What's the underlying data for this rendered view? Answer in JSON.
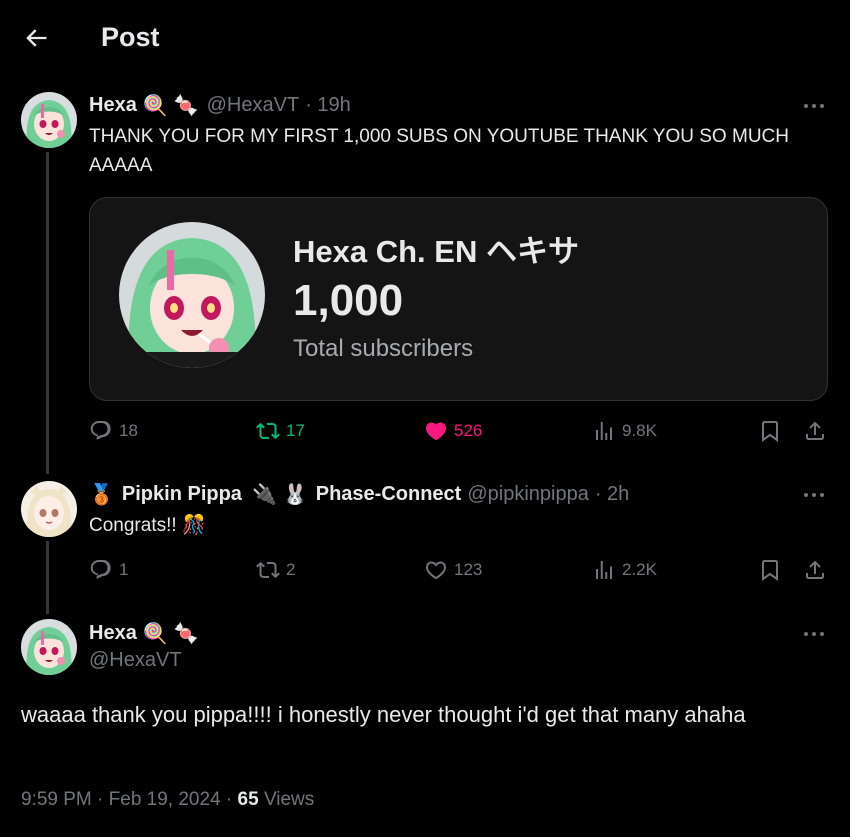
{
  "header": {
    "title": "Post"
  },
  "tweet1": {
    "name": "Hexa",
    "emojis": [
      "🍭",
      "🍬"
    ],
    "handle": "@HexaVT",
    "time": "· 19h",
    "text": "THANK YOU FOR MY FIRST 1,000 SUBS ON YOUTUBE THANK YOU SO MUCH AAAAA",
    "card": {
      "channel": "Hexa Ch. EN ヘキサ",
      "count": "1,000",
      "label": "Total subscribers"
    },
    "stats": {
      "replies": "18",
      "reposts": "17",
      "likes": "526",
      "views": "9.8K"
    }
  },
  "tweet2": {
    "badge": "🥉",
    "name": "Pipkin Pippa",
    "emojis": [
      "🔌",
      "🐰"
    ],
    "affiliation": "Phase-Connect",
    "handle": "@pipkinpippa",
    "time": "· 2h",
    "text": "Congrats!!",
    "text_emoji": "🎊",
    "stats": {
      "replies": "1",
      "reposts": "2",
      "likes": "123",
      "views": "2.2K"
    }
  },
  "tweet3": {
    "name": "Hexa",
    "emojis": [
      "🍭",
      "🍬"
    ],
    "handle": "@HexaVT",
    "text": "waaaa thank you pippa!!!! i honestly never thought i'd get that many ahaha",
    "time": "9:59 PM · Feb 19, 2024 ·",
    "views_count": "65",
    "views_label": "Views"
  },
  "colors": {
    "background": "#000000",
    "text": "#e7e9ea",
    "muted": "#71767b",
    "repost_active": "#00ba7c",
    "like_active": "#f91880",
    "avatar_hair": "#6fcf97"
  }
}
